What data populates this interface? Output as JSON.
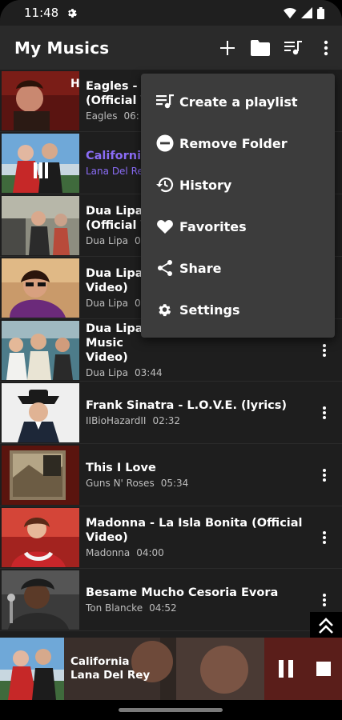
{
  "status_bar": {
    "time": "11:48"
  },
  "app_bar": {
    "title": "My Musics"
  },
  "songs": [
    {
      "title": "Eagles - H\n(Official V",
      "artist": "Eagles",
      "duration": "06:"
    },
    {
      "title": "California",
      "artist": "Lana Del Re",
      "duration": "",
      "active": true
    },
    {
      "title": "Dua Lipa -\n(Official V",
      "artist": "Dua Lipa",
      "duration": "0"
    },
    {
      "title": "Dua Lipa -\nVideo)",
      "artist": "Dua Lipa",
      "duration": "0"
    },
    {
      "title": "Dua Lipa - New Rules (Official Music\nVideo)",
      "artist": "Dua Lipa",
      "duration": "03:44"
    },
    {
      "title": "Frank Sinatra - L.O.V.E. (lyrics)",
      "artist": "IIBioHazardII",
      "duration": "02:32"
    },
    {
      "title": "This I Love",
      "artist": "Guns N' Roses",
      "duration": "05:34"
    },
    {
      "title": "Madonna - La Isla Bonita (Official\nVideo)",
      "artist": "Madonna",
      "duration": "04:00"
    },
    {
      "title": "Besame Mucho Cesoria Evora",
      "artist": "Ton Blancke",
      "duration": "04:52"
    }
  ],
  "menu": {
    "items": [
      {
        "label": "Create a playlist",
        "icon": "playlist-add-icon"
      },
      {
        "label": "Remove Folder",
        "icon": "remove-circle-icon"
      },
      {
        "label": "History",
        "icon": "history-icon"
      },
      {
        "label": "Favorites",
        "icon": "heart-icon"
      },
      {
        "label": "Share",
        "icon": "share-icon"
      },
      {
        "label": "Settings",
        "icon": "gear-icon"
      }
    ]
  },
  "mini_player": {
    "title": "California",
    "artist": "Lana Del Rey"
  },
  "colors": {
    "accent": "#8a6cf5",
    "background": "#1e1e1e",
    "app_bar": "#2a2a2a",
    "menu": "#3c3c3c"
  }
}
